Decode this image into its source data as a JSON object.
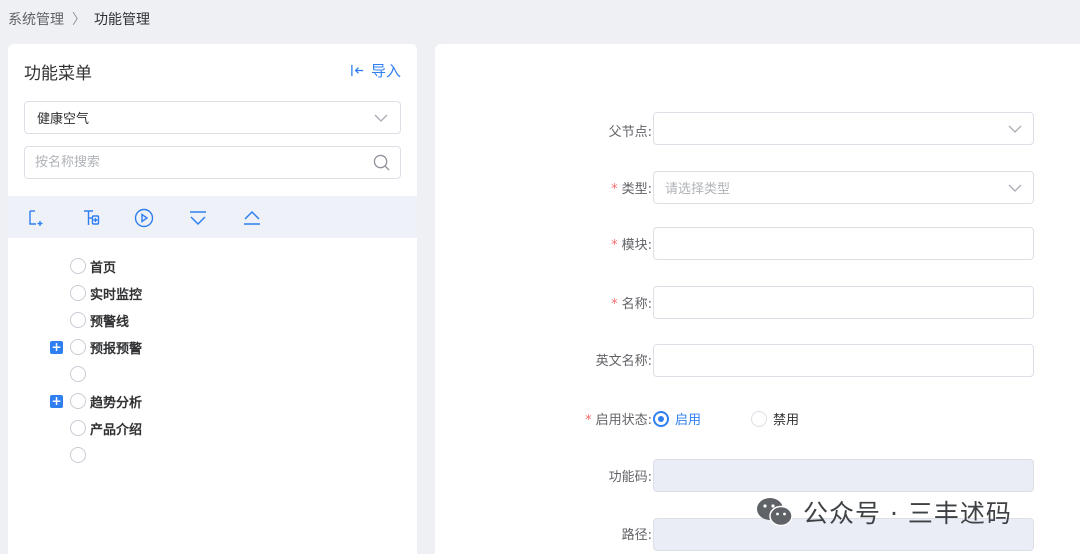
{
  "breadcrumb": {
    "root": "系统管理",
    "separator": "〉",
    "current": "功能管理"
  },
  "left": {
    "title": "功能菜单",
    "import_label": "导入",
    "selected_category": "健康空气",
    "search_placeholder": "按名称搜索",
    "toolbar_icons": [
      "add-root-icon",
      "add-child-icon",
      "play-circle-icon",
      "expand-all-icon",
      "collapse-all-icon"
    ],
    "tree": [
      {
        "label": "首页",
        "expandable": false
      },
      {
        "label": "实时监控",
        "expandable": false
      },
      {
        "label": "预警线",
        "expandable": false
      },
      {
        "label": "预报预警",
        "expandable": true
      },
      {
        "label": "",
        "expandable": false
      },
      {
        "label": "趋势分析",
        "expandable": true
      },
      {
        "label": "产品介绍",
        "expandable": false
      },
      {
        "label": "",
        "expandable": false
      }
    ],
    "expand_symbol": "+"
  },
  "form": {
    "parent_label": "父节点:",
    "type_label": "类型:",
    "type_placeholder": "请选择类型",
    "module_label": "模块:",
    "name_label": "名称:",
    "en_name_label": "英文名称:",
    "status_label": "启用状态:",
    "status_enable": "启用",
    "status_disable": "禁用",
    "status_selected": "启用",
    "code_label": "功能码:",
    "path_label": "路径:",
    "required_mark": "*"
  },
  "watermark": {
    "text": "公众号 · 三丰述码"
  },
  "colors": {
    "accent": "#2f7ff0",
    "required": "#f56c6c",
    "background": "#eef0f4"
  }
}
